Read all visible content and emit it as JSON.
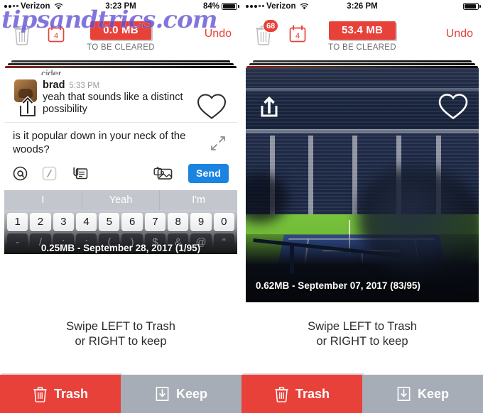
{
  "watermark": {
    "text": "tipsandtrics.com"
  },
  "panels": [
    {
      "id": "left",
      "statusbar": {
        "carrier": "Verizon",
        "wifi_icon": "wifi-icon",
        "time": "3:23 PM",
        "battery_percent": "84%",
        "battery_level": 84
      },
      "toolbar": {
        "trash_icon": "trash-icon",
        "trash_badge": "",
        "calendar_icon": "calendar-icon",
        "calendar_value": "4",
        "size_badge": "0.0 MB",
        "size_sublabel": "TO BE CLEARED",
        "undo_label": "Undo",
        "accent_color": "#e8413a"
      },
      "card": {
        "type": "chat",
        "share_icon": "share-icon",
        "heart_icon": "heart-icon",
        "cut_text": "cider.",
        "message": {
          "user": "brad",
          "time": "5:33 PM",
          "text": "yeah that sounds like a distinct possibility",
          "avatar_icon": "avatar"
        },
        "composer": {
          "text": "is it popular down in your neck of the woods?",
          "expand_icon": "expand-icon",
          "tools": [
            {
              "icon": "mention-icon",
              "glyph": "@"
            },
            {
              "icon": "slash-command-icon",
              "glyph": "/"
            },
            {
              "icon": "attachment-icon",
              "glyph": ""
            },
            {
              "icon": "photo-icon",
              "glyph": ""
            }
          ],
          "send_label": "Send"
        },
        "keyboard": {
          "suggestions": [
            "I",
            "Yeah",
            "I'm"
          ],
          "number_row": [
            "1",
            "2",
            "3",
            "4",
            "5",
            "6",
            "7",
            "8",
            "9",
            "0"
          ],
          "punct_row": [
            "-",
            "/",
            ":",
            ";",
            "(",
            ")",
            "$",
            "&",
            "@",
            "\""
          ]
        },
        "caption": "0.25MB - September 28, 2017 (1/95)"
      },
      "hint": {
        "line1": "Swipe LEFT to Trash",
        "line2": "or RIGHT to keep"
      },
      "actions": {
        "trash_label": "Trash",
        "trash_icon": "trash-icon",
        "trash_color": "#e8413a",
        "keep_label": "Keep",
        "keep_icon": "download-box-icon",
        "keep_color": "#a6adb6"
      }
    },
    {
      "id": "right",
      "statusbar": {
        "carrier": "Verizon",
        "wifi_icon": "wifi-icon",
        "time": "3:26 PM",
        "battery_percent": "",
        "battery_level": 80
      },
      "toolbar": {
        "trash_icon": "trash-icon",
        "trash_badge": "68",
        "calendar_icon": "calendar-icon",
        "calendar_value": "4",
        "size_badge": "53.4 MB",
        "size_sublabel": "TO BE CLEARED",
        "undo_label": "Undo",
        "accent_color": "#e8413a"
      },
      "card": {
        "type": "photo",
        "share_icon": "share-icon",
        "heart_icon": "heart-icon",
        "photo_subject": "tennis-stadium-photo",
        "caption": "0.62MB - September 07, 2017 (83/95)"
      },
      "hint": {
        "line1": "Swipe LEFT to Trash",
        "line2": "or RIGHT to keep"
      },
      "actions": {
        "trash_label": "Trash",
        "trash_icon": "trash-icon",
        "trash_color": "#e8413a",
        "keep_label": "Keep",
        "keep_icon": "download-box-icon",
        "keep_color": "#a6adb6"
      }
    }
  ]
}
